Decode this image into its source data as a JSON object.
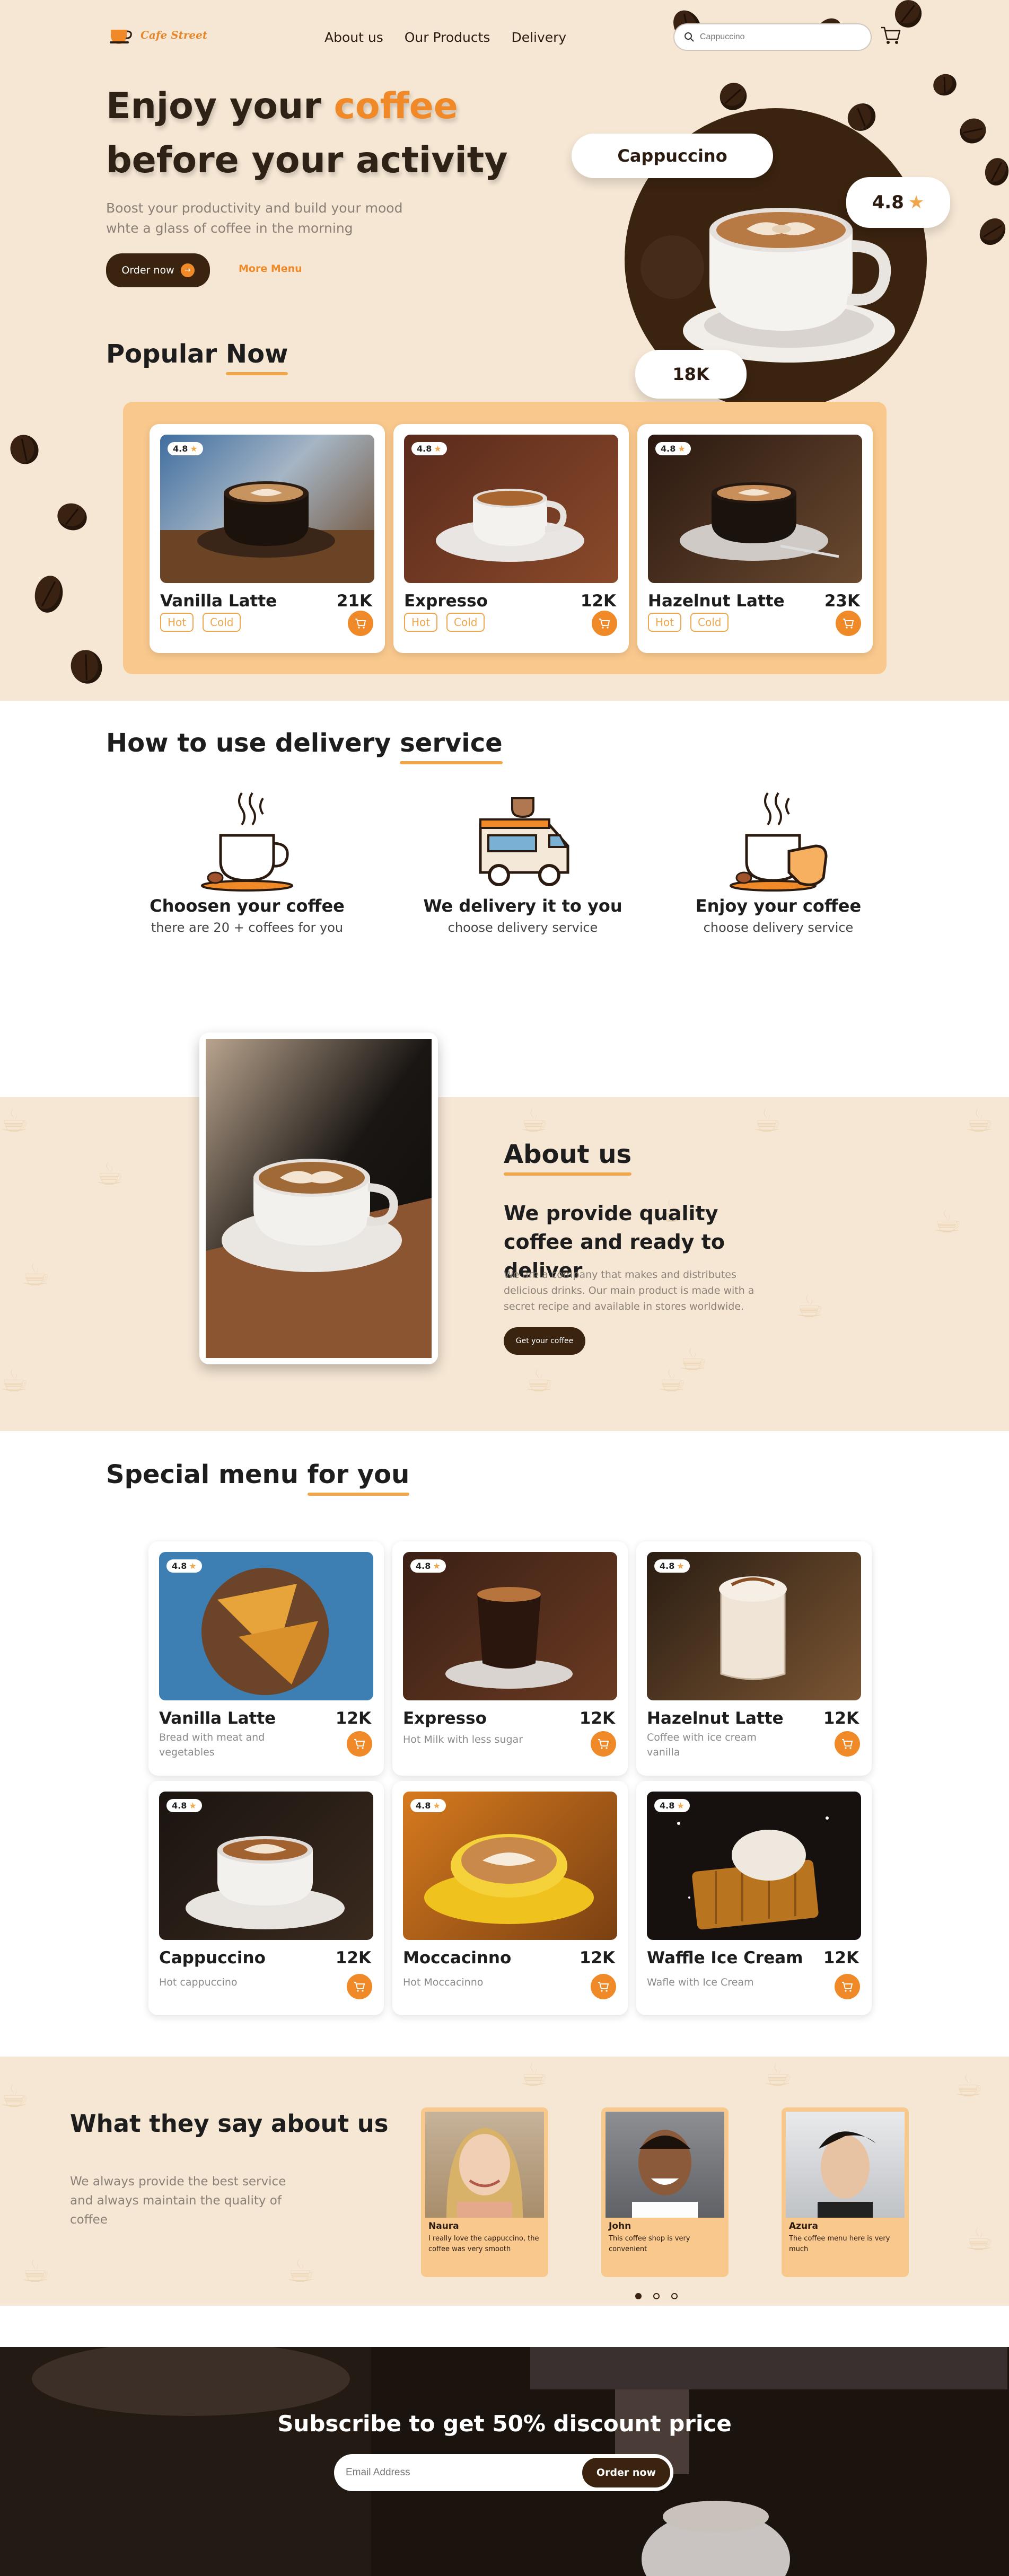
{
  "brand": {
    "name": "Cafe Street"
  },
  "nav": {
    "items": [
      "About us",
      "Our Products",
      "Delivery"
    ]
  },
  "search": {
    "placeholder": "Cappuccino"
  },
  "hero": {
    "title_line1_a": "Enjoy your ",
    "title_line1_b": "coffee",
    "title_line2": "before your activity",
    "subtitle": "Boost your productivity and build your mood whte a glass of coffee in the morning",
    "order_button": "Order now",
    "more_menu": "More Menu",
    "product_badge": "Cappuccino",
    "rating": "4.8",
    "price_badge": "18K"
  },
  "popular": {
    "title_a": "Popular ",
    "title_b": "Now",
    "items": [
      {
        "rating": "4.8",
        "name": "Vanilla Latte",
        "price": "21K",
        "tags": [
          "Hot",
          "Cold"
        ]
      },
      {
        "rating": "4.8",
        "name": "Expresso",
        "price": "12K",
        "tags": [
          "Hot",
          "Cold"
        ]
      },
      {
        "rating": "4.8",
        "name": "Hazelnut Latte",
        "price": "23K",
        "tags": [
          "Hot",
          "Cold"
        ]
      }
    ]
  },
  "how": {
    "title_a": "How to use delivery ",
    "title_b": "service",
    "steps": [
      {
        "title": "Choosen your coffee",
        "sub": "there are 20 + coffees for you"
      },
      {
        "title": "We delivery it to you",
        "sub": "choose delivery service"
      },
      {
        "title": "Enjoy your coffee",
        "sub": "choose delivery service"
      }
    ]
  },
  "about": {
    "title": "About us",
    "headline": "We provide quality coffee and ready to deliver",
    "body": "We are a company that makes and distributes delicious drinks. Our main product is made with a secret recipe and available in stores worldwide.",
    "button": "Get your coffee"
  },
  "special": {
    "title_a": "Special menu ",
    "title_b": "for you",
    "items": [
      {
        "rating": "4.8",
        "name": "Vanilla Latte",
        "price": "12K",
        "desc": "Bread with meat and vegetables"
      },
      {
        "rating": "4.8",
        "name": "Expresso",
        "price": "12K",
        "desc": "Hot Milk with less sugar"
      },
      {
        "rating": "4.8",
        "name": "Hazelnut Latte",
        "price": "12K",
        "desc": "Coffee with ice cream vanilla"
      },
      {
        "rating": "4.8",
        "name": "Cappuccino",
        "price": "12K",
        "desc": "Hot cappuccino"
      },
      {
        "rating": "4.8",
        "name": "Moccacinno",
        "price": "12K",
        "desc": "Hot Moccacinno"
      },
      {
        "rating": "4.8",
        "name": "Waffle Ice Cream",
        "price": "12K",
        "desc": "Wafle with Ice Cream"
      }
    ]
  },
  "testimonials": {
    "title": "What they say about us",
    "sub": "We always provide the best service and always maintain the quality of coffee",
    "items": [
      {
        "name": "Naura",
        "text": "I really love the cappuccino, the coffee was very smooth"
      },
      {
        "name": "John",
        "text": "This coffee shop is very convenient"
      },
      {
        "name": "Azura",
        "text": "The coffee menu here is very much"
      }
    ]
  },
  "subscribe": {
    "title": "Subscribe to get 50% discount price",
    "placeholder": "Email Address",
    "button": "Order now"
  },
  "colors": {
    "accent": "#f08a28",
    "dark": "#3a230f",
    "cream": "#f6e7d4",
    "peach": "#f9c88d"
  }
}
